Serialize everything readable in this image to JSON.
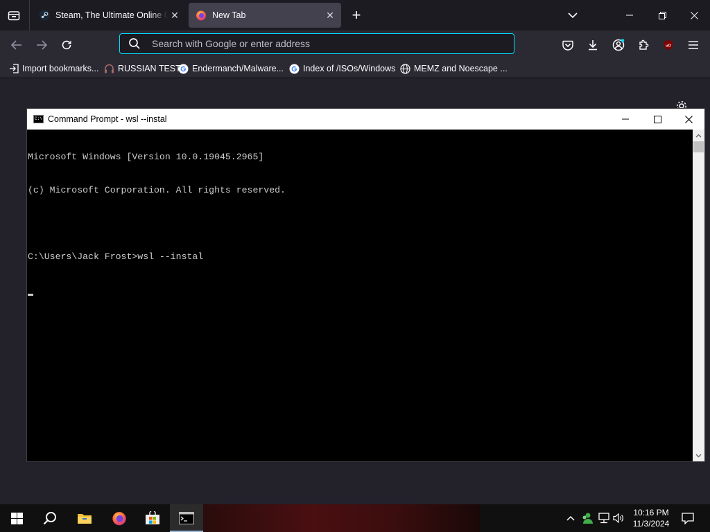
{
  "browser": {
    "tabs": [
      {
        "title": "Steam, The Ultimate Online Game Platform",
        "favicon": "steam-icon",
        "active": false
      },
      {
        "title": "New Tab",
        "favicon": "firefox-icon",
        "active": true
      }
    ],
    "urlbar": {
      "placeholder": "Search with Google or enter address",
      "value": ""
    },
    "bookmarks": [
      {
        "label": "Import bookmarks...",
        "icon": "import-icon"
      },
      {
        "label": "RUSSIAN TEST",
        "icon": "headset-icon"
      },
      {
        "label": "Endermanch/Malware...",
        "icon": "google-icon"
      },
      {
        "label": "Index of /ISOs/Windows",
        "icon": "google-icon"
      },
      {
        "label": "MEMZ and Noescape ...",
        "icon": "globe-icon"
      }
    ],
    "accent_color": "#00ddff"
  },
  "cmd": {
    "title": "Command Prompt - wsl  --instal",
    "lines": [
      "Microsoft Windows [Version 10.0.19045.2965]",
      "(c) Microsoft Corporation. All rights reserved.",
      "",
      "C:\\Users\\Jack Frost>wsl --instal"
    ]
  },
  "taskbar": {
    "apps": [
      "start-icon",
      "search-icon",
      "file-explorer-icon",
      "firefox-icon",
      "store-icon",
      "cmd-icon"
    ],
    "time": "10:16 PM",
    "date": "11/3/2024"
  }
}
